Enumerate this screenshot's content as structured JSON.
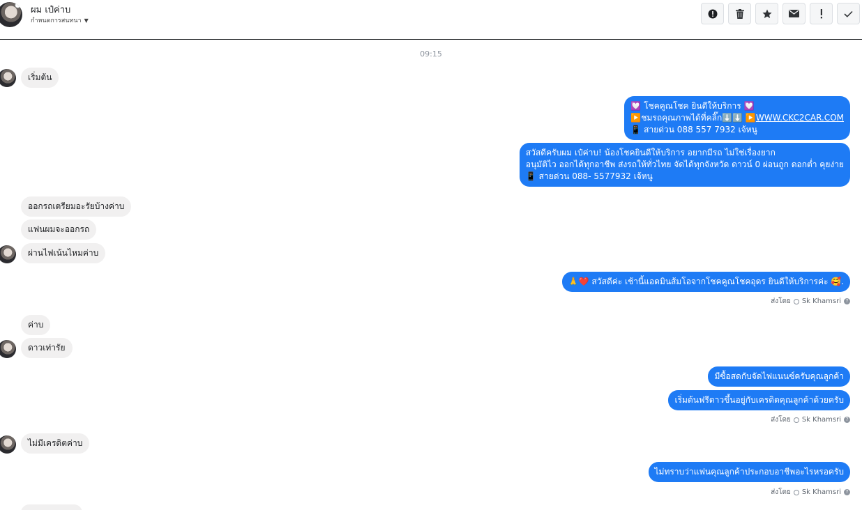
{
  "header": {
    "contact_name": "ผม เป๋ค่าบ",
    "conversation_settings": "กำหนดการสนทนา",
    "toolbar": [
      {
        "name": "report-button",
        "icon": "exclamation-circle-icon"
      },
      {
        "name": "delete-button",
        "icon": "trash-icon"
      },
      {
        "name": "star-button",
        "icon": "star-icon"
      },
      {
        "name": "mark-unread-button",
        "icon": "envelope-icon"
      },
      {
        "name": "important-button",
        "icon": "exclamation-icon"
      },
      {
        "name": "mark-done-button",
        "icon": "checkmark-icon"
      }
    ]
  },
  "thread": {
    "timestamp": "09:15",
    "incoming": {
      "m1": "เริ่มต้น",
      "m2": "ออกรถเตรียมอะรัยบ้างค่าบ",
      "m3": "แฟนผมจะออกรถ",
      "m4": "ผ่านไฟเน้นไหมค่าบ",
      "m5": "ค่าบ",
      "m6": "ดาวเท่ารัย",
      "m7": "ไม่มีเครดิตค่าบ"
    },
    "outgoing": {
      "o1": {
        "line1": "💟 โชคคูณโชค ยินดีให้บริการ 💟",
        "line2": "▶️ชมรถคุณภาพได้ที่คลิ๊ก⬇️⬇️      ▶️",
        "link": "WWW.CKC2CAR.COM",
        "line3": "📱 สายด่วน 088 557 7932 เจ้หนู"
      },
      "o2": {
        "line1": "สวัสดีครับผม เป๋ค่าบ! น้องโชคยินดีให้บริการ อยากมีรถ ไม่ใช่เรื่องยาก",
        "line2": "อนุมัติไว ออกได้ทุกอาชีพ ส่งรถให้ทั่วไทย จัดได้ทุกจังหวัด ดาวน์ 0  ผ่อนถูก ดอกต่ำ คุยง่าย",
        "line3": "📱 สายด่วน 088- 5577932 เจ้หนู"
      },
      "o3": "🙏❤️ สวัสดีค่ะ เช้านี้แอดมินส้มโอจากโชคคูณโชคอุดร ยินดีให้บริการค่ะ 🥰.",
      "o4": "มีซื้อสดกับจัดไฟแนนซ์ครับคุณลูกค้า",
      "o5": "เริ่มต้นฟรีดาวขึ้นอยู่กับเครดิตคุณลูกค้าด้วยครับ",
      "o6": "ไม่ทราบว่าแฟนคุณลูกค้าประกอบอาชีพอะไรหรอครับ"
    },
    "sent_by": {
      "prefix": "ส่งโดย",
      "name": "Sk Khamsri"
    }
  },
  "colors": {
    "outgoing_bubble": "#1e7bf5",
    "incoming_bubble": "#f1f0f0"
  }
}
